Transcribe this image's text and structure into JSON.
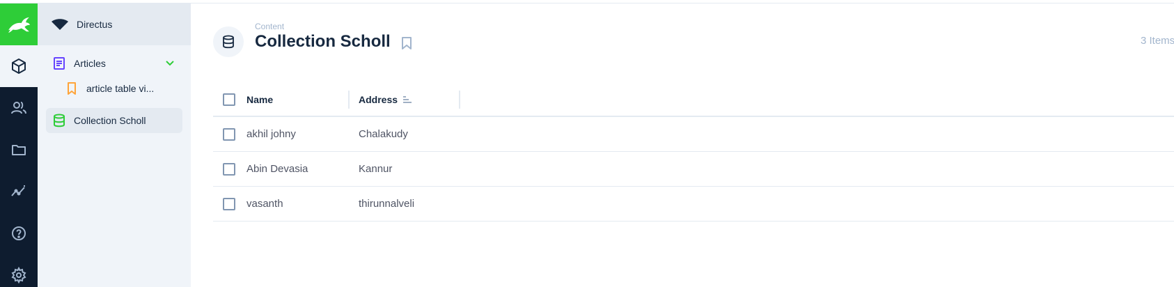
{
  "project": {
    "name": "Directus"
  },
  "modules": [
    {
      "name": "content",
      "icon": "box-icon",
      "active": true
    },
    {
      "name": "users",
      "icon": "users-icon",
      "active": false
    },
    {
      "name": "files",
      "icon": "folder-icon",
      "active": false
    },
    {
      "name": "insights",
      "icon": "insights-icon",
      "active": false
    },
    {
      "name": "help",
      "icon": "help-icon",
      "active": false
    },
    {
      "name": "settings",
      "icon": "gear-icon",
      "active": false
    }
  ],
  "nav": {
    "items": [
      {
        "label": "Articles",
        "icon": "article-icon",
        "color": "#6644ff",
        "expandable": true
      },
      {
        "label": "article table vi...",
        "icon": "bookmark-icon",
        "color": "#ffa439",
        "indent": true
      },
      {
        "label": "Collection Scholl",
        "icon": "database-icon",
        "color": "#2ecd38",
        "active": true
      }
    ]
  },
  "header": {
    "breadcrumb": "Content",
    "title": "Collection Scholl",
    "items_count": "3 Items"
  },
  "table": {
    "columns": [
      "Name",
      "Address"
    ],
    "rows": [
      {
        "name": "akhil johny",
        "address": "Chalakudy"
      },
      {
        "name": "Abin Devasia",
        "address": "Kannur"
      },
      {
        "name": "vasanth",
        "address": "thirunnalveli"
      }
    ]
  },
  "colors": {
    "brand": "#2ecd38",
    "module_bar": "#0e1c2f",
    "nav_bg": "#f0f4f9",
    "text": "#172940",
    "muted": "#a2b5cd"
  }
}
